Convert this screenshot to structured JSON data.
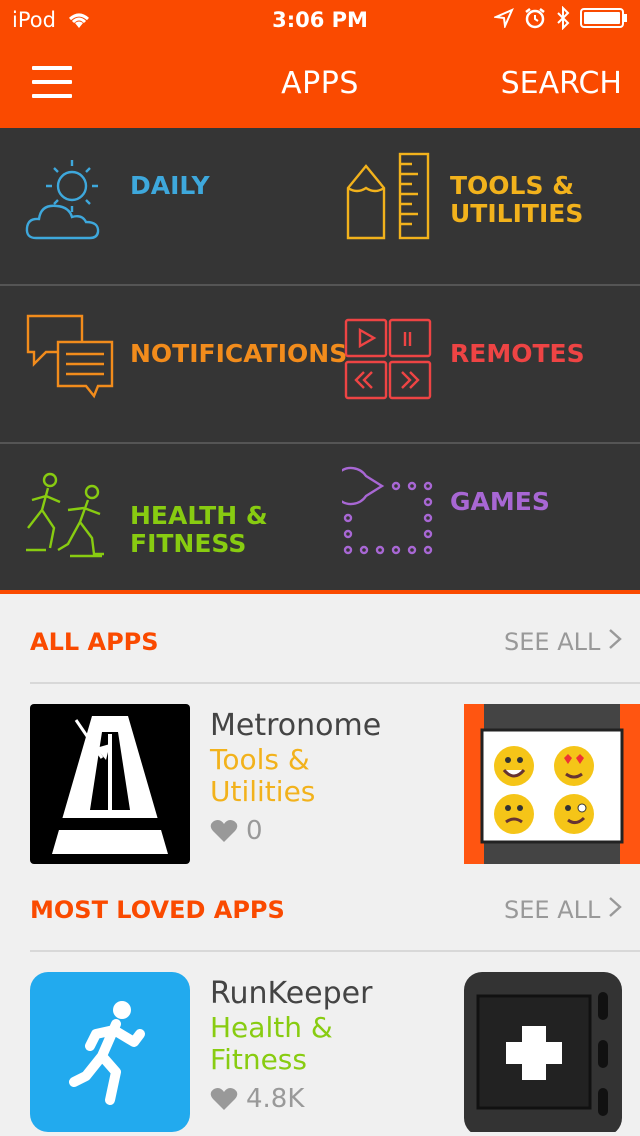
{
  "status": {
    "carrier": "iPod",
    "time": "3:06 PM"
  },
  "nav": {
    "title": "APPS",
    "search": "SEARCH"
  },
  "categories": [
    {
      "label": "DAILY",
      "color": "#3ea8dc",
      "icon": "weather-icon"
    },
    {
      "label": "TOOLS & UTILITIES",
      "color": "#f2b21c",
      "icon": "pencil-ruler-icon"
    },
    {
      "label": "NOTIFICATIONS",
      "color": "#f28c1c",
      "icon": "chat-bubbles-icon"
    },
    {
      "label": "REMOTES",
      "color": "#ee4444",
      "icon": "media-controls-icon"
    },
    {
      "label": "HEALTH & FITNESS",
      "color": "#88cc11",
      "icon": "runners-icon"
    },
    {
      "label": "GAMES",
      "color": "#a867d4",
      "icon": "pacman-icon"
    }
  ],
  "sections": {
    "all_apps": {
      "title": "ALL APPS",
      "see_all": "SEE ALL",
      "app": {
        "name": "Metronome",
        "category": "Tools & Utilities",
        "category_color": "#f2b21c",
        "likes": "0"
      }
    },
    "most_loved": {
      "title": "MOST LOVED APPS",
      "see_all": "SEE ALL",
      "app": {
        "name": "RunKeeper",
        "category": "Health & Fitness",
        "category_color": "#88cc11",
        "likes": "4.8K"
      }
    }
  }
}
